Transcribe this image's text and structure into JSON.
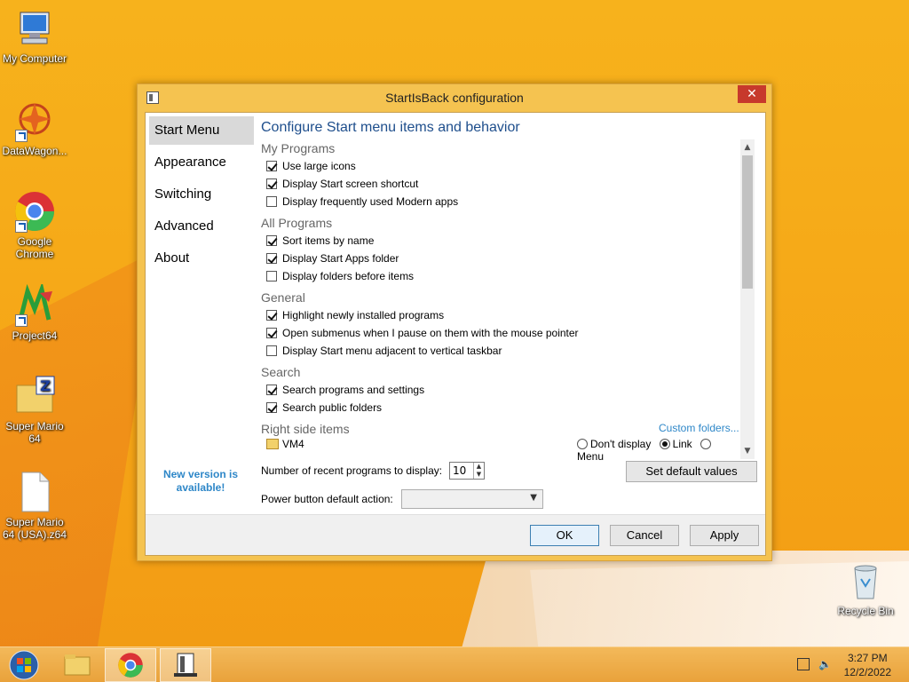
{
  "desktop": {
    "icons": [
      {
        "label": "My Computer"
      },
      {
        "label": "DataWagon..."
      },
      {
        "label": "Google Chrome"
      },
      {
        "label": "Project64"
      },
      {
        "label": "Super Mario 64"
      },
      {
        "label": "Super Mario 64 (USA).z64"
      },
      {
        "label": "Recycle Bin"
      }
    ]
  },
  "dialog": {
    "title": "StartIsBack configuration",
    "close_glyph": "✕",
    "nav": {
      "items": [
        {
          "label": "Start Menu"
        },
        {
          "label": "Appearance"
        },
        {
          "label": "Switching"
        },
        {
          "label": "Advanced"
        },
        {
          "label": "About"
        }
      ],
      "new_version": "New version is available!"
    },
    "heading": "Configure Start menu items and behavior",
    "groups": {
      "my_programs": {
        "title": "My Programs",
        "items": [
          {
            "label": "Use large icons",
            "checked": true
          },
          {
            "label": "Display Start screen shortcut",
            "checked": true
          },
          {
            "label": "Display frequently used Modern apps",
            "checked": false
          }
        ]
      },
      "all_programs": {
        "title": "All Programs",
        "items": [
          {
            "label": "Sort items by name",
            "checked": true
          },
          {
            "label": "Display Start Apps folder",
            "checked": true
          },
          {
            "label": "Display folders before items",
            "checked": false
          }
        ]
      },
      "general": {
        "title": "General",
        "items": [
          {
            "label": "Highlight newly installed programs",
            "checked": true
          },
          {
            "label": "Open submenus when I pause on them with the mouse pointer",
            "checked": true
          },
          {
            "label": "Display Start menu adjacent to vertical taskbar",
            "checked": false
          }
        ]
      },
      "search": {
        "title": "Search",
        "items": [
          {
            "label": "Search programs and settings",
            "checked": true
          },
          {
            "label": "Search public folders",
            "checked": true
          }
        ]
      }
    },
    "right_side": {
      "title": "Right side items",
      "custom_folders": "Custom folders...",
      "item_label": "VM4",
      "options": {
        "dont_display": "Don't display",
        "link": "Link",
        "menu": "Menu"
      },
      "selected": "Link"
    },
    "recent_label": "Number of recent programs to display:",
    "recent_value": "10",
    "set_default": "Set default values",
    "power_label": "Power button default action:",
    "power_value": "",
    "buttons": {
      "ok": "OK",
      "cancel": "Cancel",
      "apply": "Apply"
    }
  },
  "taskbar": {
    "time": "3:27 PM",
    "date": "12/2/2022"
  }
}
